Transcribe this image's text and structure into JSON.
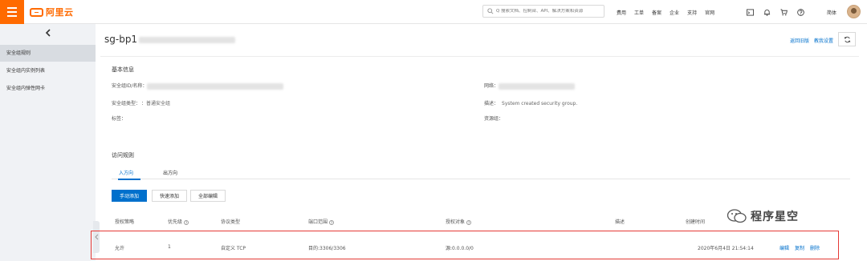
{
  "topbar": {
    "logo_text": "阿里云",
    "search_placeholder": "Q 搜索文档、控制台、API、解决方案和资源",
    "nav_links": [
      "费用",
      "工单",
      "备案",
      "企业",
      "支持",
      "官网"
    ],
    "icons": [
      "terminal-icon",
      "bell-icon",
      "cart-icon",
      "help-icon"
    ],
    "language": "简体"
  },
  "sidebar": {
    "back_icon": "chevron-left-icon",
    "items": [
      {
        "label": "安全组规则",
        "active": true
      },
      {
        "label": "安全组内实例列表",
        "active": false
      },
      {
        "label": "安全组内弹性网卡",
        "active": false
      }
    ]
  },
  "page": {
    "title": "sg-bp1",
    "links": {
      "back": "返回旧版",
      "tutorial": "教我设置"
    }
  },
  "basic_info": {
    "heading": "基本信息",
    "group_id_label": "安全组ID/名称：",
    "network_label": "网络：",
    "group_type_label": "安全组类型：",
    "group_type_value": "：普通安全组",
    "description_label": "描述：",
    "description_value": "System created security group.",
    "tags_label": "标签：",
    "resource_group_label": "资源组："
  },
  "access_rules": {
    "heading": "访问规则",
    "tabs": [
      {
        "label": "入方向",
        "active": true
      },
      {
        "label": "出方向",
        "active": false
      }
    ],
    "buttons": {
      "manual_add": "手动添加",
      "quick_add": "快速添加",
      "all_edit": "全部编辑"
    },
    "columns": [
      "授权策略",
      "优先级",
      "协议类型",
      "端口范围",
      "授权对象",
      "描述",
      "创建时间"
    ],
    "rows": [
      {
        "policy": "允许",
        "priority": "1",
        "protocol": "自定义 TCP",
        "port": "目的:3306/3306",
        "object": "源:0.0.0.0/0",
        "description": "",
        "created": "2020年6月4日 21:54:14",
        "actions": [
          "编辑",
          "复制",
          "删除"
        ]
      }
    ]
  },
  "watermark": {
    "text": "程序星空"
  },
  "colors": {
    "accent": "#ff6a00",
    "primary": "#0070cc",
    "highlight_box": "#e53935"
  }
}
